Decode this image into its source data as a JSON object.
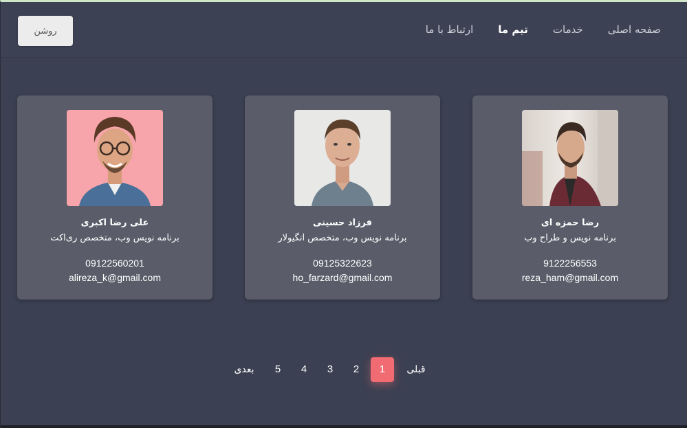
{
  "header": {
    "theme_button": "روشن",
    "nav": [
      {
        "label": "صفحه اصلی"
      },
      {
        "label": "خدمات"
      },
      {
        "label": "تیم ما"
      },
      {
        "label": "ارتباط با ما"
      }
    ],
    "active_index": 2
  },
  "team": [
    {
      "name": "رضا حمزه ای",
      "role": "برنامه نویس و طراح وب",
      "phone": "9122256553",
      "email": "reza_ham@gmail.com"
    },
    {
      "name": "فرزاد حسینی",
      "role": "برنامه نویس وب، متخصص انگیولار",
      "phone": "09125322623",
      "email": "ho_farzard@gmail.com"
    },
    {
      "name": "علی رضا اکبری",
      "role": "برنامه نویس وب، متخصص ری‌اکت",
      "phone": "09122560201",
      "email": "alireza_k@gmail.com"
    }
  ],
  "pagination": {
    "prev": "قبلی",
    "next": "بعدی",
    "pages": [
      "1",
      "2",
      "3",
      "4",
      "5"
    ],
    "current": "1"
  },
  "colors": {
    "background": "#3b4052",
    "card": "#5a5d69",
    "accent": "#f06b72"
  }
}
